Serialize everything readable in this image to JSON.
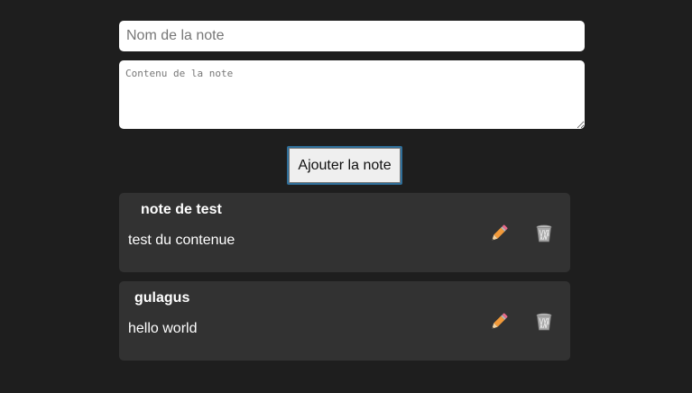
{
  "form": {
    "title_placeholder": "Nom de la note",
    "content_placeholder": "Contenu de la note",
    "add_label": "Ajouter la note"
  },
  "notes": [
    {
      "title": "note de test",
      "content": "test du contenue",
      "edit_icon": "pencil-icon",
      "delete_icon": "trash-icon"
    },
    {
      "title": "gulagus",
      "content": "hello world",
      "edit_icon": "pencil-icon",
      "delete_icon": "trash-icon"
    }
  ],
  "colors": {
    "background": "#1e1e1e",
    "card": "#323232",
    "button_border": "#2f6f9a",
    "pencil": "#f29a3a"
  }
}
